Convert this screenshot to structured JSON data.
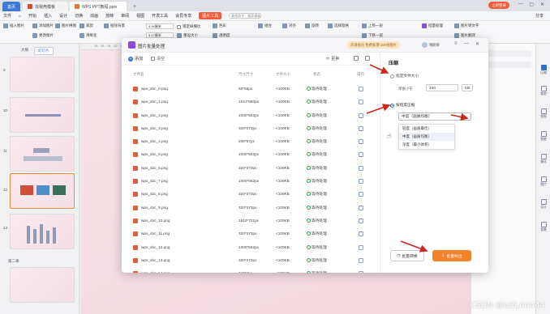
{
  "titlebar": {
    "home_tab": "首页",
    "doc_tabs": [
      "找我壳模板",
      "WPS PPT教程.pptx"
    ],
    "login_label": "立即登录",
    "minimize": "—",
    "maximize": "▢",
    "close": "✕"
  },
  "menu": {
    "items": [
      "文件",
      "⌂",
      "开始",
      "插入",
      "设计",
      "切换",
      "动画",
      "放映",
      "审阅",
      "视图",
      "开发工具",
      "会员专享"
    ],
    "special": "图片工具",
    "search_placeholder": "查找命令、搜索模板",
    "share": "分享"
  },
  "ribbon": {
    "items": [
      "插入图片",
      "添加图片",
      "更改图片",
      "图片拼图",
      "裁剪",
      "清晰化",
      "抠除背景",
      "色彩",
      "透明度",
      "组合",
      "对齐",
      "旋转",
      "选择窗格",
      "上移一层",
      "下移一层",
      "批量处理",
      "图片转文字",
      "图片翻译"
    ],
    "width_value": "4.94厘米",
    "height_value": "5.17厘米",
    "lock_ratio": "锁定纵横比",
    "reset": "重设大小"
  },
  "leftpanel": {
    "tabs": [
      "大纲",
      "幻灯片"
    ],
    "selected_tab": "幻灯片",
    "slide_numbers": [
      "9",
      "10",
      "11",
      "12",
      "13"
    ],
    "section": "第二章"
  },
  "canvas": {
    "ruler_text": "18 · 16 · 14 · 12 · 10 · 8 · 6 · 4 · 2 · 0 · 2 · 4 · 6"
  },
  "rightbar": {
    "items": [
      "压缩",
      "裁剪",
      "抠图",
      "智能",
      "美化",
      "图片",
      "设计",
      "背景"
    ]
  },
  "dialog": {
    "title": "图片批量处理",
    "vip_tag": "开通会员 免费处理 100张图片",
    "user": "晴朗果",
    "add_label": "添加",
    "clear_label": "清空",
    "change_label": "更换",
    "columns": [
      "文件名",
      "尺寸尺寸",
      "文件大小",
      "状态",
      "操作"
    ],
    "rows": [
      {
        "name": "wps_doc_0.png",
        "dim": "65*65px",
        "size": "<100KB",
        "status": "等待处理"
      },
      {
        "name": "wps_doc_1.png",
        "dim": "1021*580px",
        "size": "<100KB",
        "status": "等待处理"
      },
      {
        "name": "wps_doc_2.png",
        "dim": "1000*562px",
        "size": "<100KB",
        "status": "等待处理"
      },
      {
        "name": "wps_doc_3.png",
        "dim": "320*273px",
        "size": "<100KB",
        "status": "等待处理"
      },
      {
        "name": "wps_doc_4.png",
        "dim": "206*67px",
        "size": "<100KB",
        "status": "等待处理"
      },
      {
        "name": "wps_doc_5.png",
        "dim": "1000*562px",
        "size": "<100KB",
        "status": "等待处理"
      },
      {
        "name": "wps_doc_6.png",
        "dim": "320*273px",
        "size": "<100KB",
        "status": "等待处理"
      },
      {
        "name": "wps_doc_7.png",
        "dim": "1000*562px",
        "size": "<100KB",
        "status": "等待处理"
      },
      {
        "name": "wps_doc_8.png",
        "dim": "320*273px",
        "size": "<100KB",
        "status": "等待处理"
      },
      {
        "name": "wps_doc_9.png",
        "dim": "320*273px",
        "size": "<100KB",
        "status": "等待处理"
      },
      {
        "name": "wps_doc_10.png",
        "dim": "1610*721px",
        "size": "<100KB",
        "status": "等待处理"
      },
      {
        "name": "wps_doc_11.png",
        "dim": "320*273px",
        "size": "<100KB",
        "status": "等待处理"
      },
      {
        "name": "wps_doc_12.png",
        "dim": "1000*562px",
        "size": "<100KB",
        "status": "等待处理"
      },
      {
        "name": "wps_doc_13.png",
        "dim": "320*273px",
        "size": "<100KB",
        "status": "等待处理"
      },
      {
        "name": "wps_doc_14.png",
        "dim": "74*74px",
        "size": "<100KB",
        "status": "等待处理"
      }
    ],
    "settings": {
      "title": "压缩",
      "option1": "指定文件大小",
      "size_label": "单张小于",
      "size_value": "100",
      "size_unit": "KB",
      "option2": "按程度压缩",
      "level_selected": "中度（画质均衡）",
      "level_options": [
        "轻度（画质最佳）",
        "中度（画质均衡）",
        "深度（最小体积）"
      ],
      "convert_btn": "批量转换",
      "export_btn": "批量导出"
    }
  },
  "watermark": "CSDN @LOLA4444",
  "colors": {
    "accent": "#2f6fd6",
    "export_orange": "#f4822b",
    "annotation_red": "#c8281e"
  }
}
